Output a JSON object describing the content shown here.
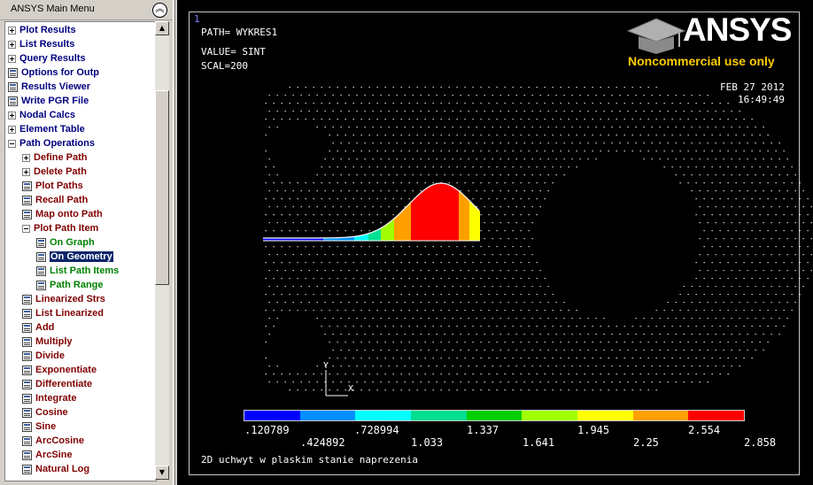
{
  "menu": {
    "title": "ANSYS Main Menu",
    "collapse_icon": "chevron-up-double-icon",
    "items": [
      {
        "label": "Plot Results",
        "icon": "plus",
        "level": 0
      },
      {
        "label": "List Results",
        "icon": "plus",
        "level": 0
      },
      {
        "label": "Query Results",
        "icon": "plus",
        "level": 0
      },
      {
        "label": "Options for Outp",
        "icon": "leaf",
        "level": 0
      },
      {
        "label": "Results Viewer",
        "icon": "leaf",
        "level": 0
      },
      {
        "label": "Write PGR File",
        "icon": "leaf",
        "level": 0
      },
      {
        "label": "Nodal Calcs",
        "icon": "plus",
        "level": 0
      },
      {
        "label": "Element Table",
        "icon": "plus",
        "level": 0
      },
      {
        "label": "Path Operations",
        "icon": "minus",
        "level": 0
      },
      {
        "label": "Define Path",
        "icon": "plus",
        "level": 1
      },
      {
        "label": "Delete Path",
        "icon": "plus",
        "level": 1
      },
      {
        "label": "Plot Paths",
        "icon": "leaf",
        "level": 1
      },
      {
        "label": "Recall Path",
        "icon": "leaf",
        "level": 1
      },
      {
        "label": "Map onto Path",
        "icon": "leaf",
        "level": 1
      },
      {
        "label": "Plot Path Item",
        "icon": "minus",
        "level": 1
      },
      {
        "label": "On Graph",
        "icon": "leaf",
        "level": 2
      },
      {
        "label": "On Geometry",
        "icon": "leaf",
        "level": 2,
        "selected": true
      },
      {
        "label": "List Path Items",
        "icon": "leaf",
        "level": 2
      },
      {
        "label": "Path Range",
        "icon": "leaf",
        "level": 2
      },
      {
        "label": "Linearized Strs",
        "icon": "leaf",
        "level": 1
      },
      {
        "label": "List Linearized",
        "icon": "leaf",
        "level": 1
      },
      {
        "label": "Add",
        "icon": "leaf",
        "level": 1
      },
      {
        "label": "Multiply",
        "icon": "leaf",
        "level": 1
      },
      {
        "label": "Divide",
        "icon": "leaf",
        "level": 1
      },
      {
        "label": "Exponentiate",
        "icon": "leaf",
        "level": 1
      },
      {
        "label": "Differentiate",
        "icon": "leaf",
        "level": 1
      },
      {
        "label": "Integrate",
        "icon": "leaf",
        "level": 1
      },
      {
        "label": "Cosine",
        "icon": "leaf",
        "level": 1
      },
      {
        "label": "Sine",
        "icon": "leaf",
        "level": 1
      },
      {
        "label": "ArcCosine",
        "icon": "leaf",
        "level": 1
      },
      {
        "label": "ArcSine",
        "icon": "leaf",
        "level": 1
      },
      {
        "label": "Natural Log",
        "icon": "leaf",
        "level": 1
      }
    ]
  },
  "graphics": {
    "window_number": "1",
    "path": "PATH=  WYKRES1",
    "value": "VALUE= SINT",
    "scale": "SCAL=200",
    "date": "FEB 27 2012",
    "time": "16:49:49",
    "logo_text": "ANSYS",
    "logo_subtitle": "Noncommercial use only",
    "axis_y": "Y",
    "axis_x": "X",
    "title": "2D uchwyt w plaskim stanie naprezenia"
  },
  "legend": {
    "colors": [
      "#0000ff",
      "#0090ff",
      "#00ffff",
      "#00e090",
      "#00d000",
      "#a0ff00",
      "#ffff00",
      "#ffa000",
      "#ff0000"
    ],
    "labels_top": [
      ".120789",
      ".728994",
      "1.337",
      "1.945",
      "2.554"
    ],
    "labels_bottom": [
      ".424892",
      "1.033",
      "1.641",
      "2.25",
      "2.858"
    ]
  }
}
